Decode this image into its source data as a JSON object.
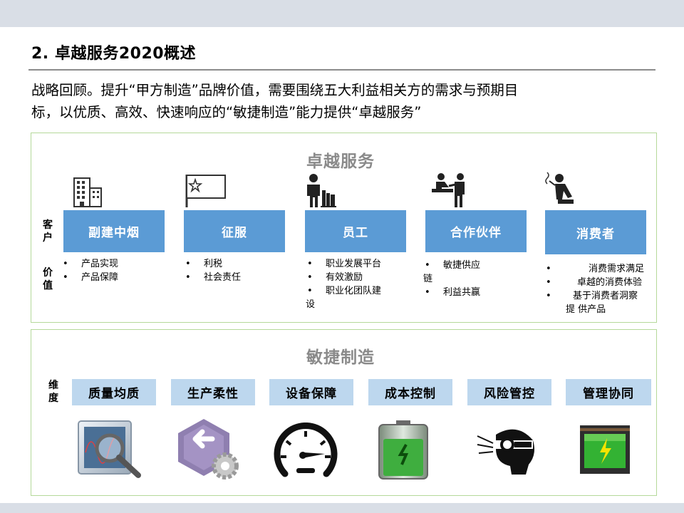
{
  "page": {
    "title": "2. 卓越服务2020概述",
    "intro_line1": "战略回顾。提升“甲方制造”品牌价值，需要围绕五大利益相关方的需求与预期目",
    "intro_line2": "标，以优质、高效、快速响应的“敏捷制造”能力提供“卓越服务”"
  },
  "service_panel": {
    "heading": "卓越服务",
    "side_label_customer": [
      "客",
      "户"
    ],
    "side_label_value": [
      "价",
      "值"
    ],
    "stakeholders": [
      {
        "label": "副建中烟",
        "icon": "office-building-icon",
        "bullets": [
          "产品实现",
          "产品保障"
        ]
      },
      {
        "label": "征服",
        "icon": "flag-icon",
        "bullets": [
          "利税",
          "社会责任"
        ]
      },
      {
        "label": "员工",
        "icon": "worker-with-books-icon",
        "bullets": [
          "职业发展平台",
          "有效激励",
          "职业化团队建",
          "设"
        ]
      },
      {
        "label": "合作伙伴",
        "icon": "partners-handshake-icon",
        "bullets": [
          "敏捷供应",
          "链",
          "利益共赢"
        ]
      },
      {
        "label": "消费者",
        "icon": "consumer-smoking-icon",
        "bullets": [
          "消费需求满足",
          "卓越的消费体验",
          "基于消费者洞察",
          "提 供产品"
        ]
      }
    ]
  },
  "agile_panel": {
    "heading": "敏捷制造",
    "side_label": [
      "维",
      "度"
    ],
    "dimensions": [
      {
        "label": "质量均质",
        "icon": "magnifier-monitor-icon"
      },
      {
        "label": "生产柔性",
        "icon": "flexible-gear-icon"
      },
      {
        "label": "设备保障",
        "icon": "speedometer-icon"
      },
      {
        "label": "成本控制",
        "icon": "battery-icon"
      },
      {
        "label": "风险管控",
        "icon": "risk-goggles-icon"
      },
      {
        "label": "管理协同",
        "icon": "charging-battery-icon"
      }
    ]
  },
  "colors": {
    "stakeholder_button": "#5b9bd5",
    "dimension_button": "#bdd7ee",
    "panel_border": "#b5d99a",
    "heading_gray": "#8a8a8a"
  }
}
